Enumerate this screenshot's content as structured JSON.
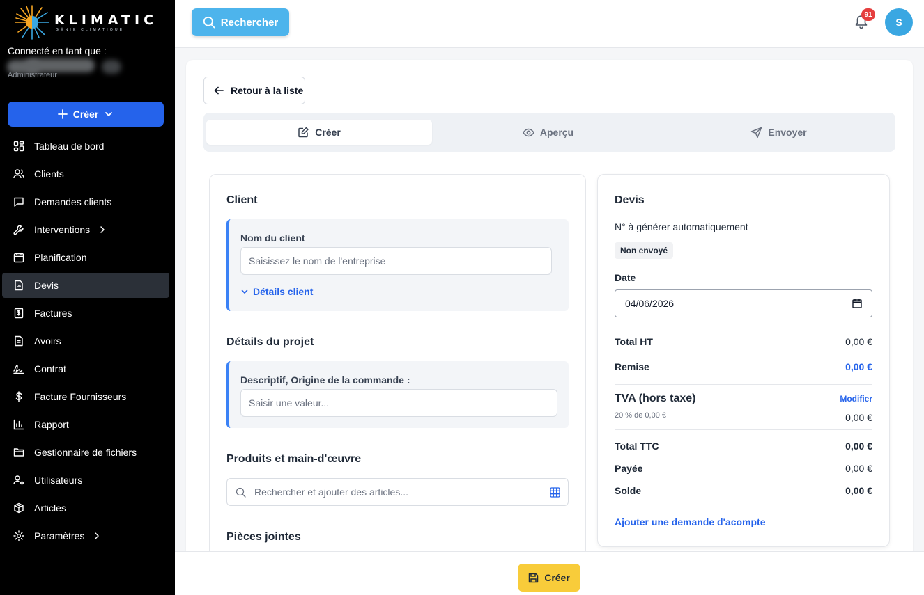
{
  "brand": {
    "name": "KLIMATIC",
    "tagline": "GÉNIE CLIMATIQUE"
  },
  "session": {
    "connected_label": "Connecté en tant que :",
    "role": "Administrateur"
  },
  "sidebar": {
    "create_label": "Créer",
    "items": [
      {
        "label": "Tableau de bord",
        "icon": "dashboard-icon"
      },
      {
        "label": "Clients",
        "icon": "users-icon"
      },
      {
        "label": "Demandes clients",
        "icon": "message-icon"
      },
      {
        "label": "Interventions",
        "icon": "wrench-icon"
      },
      {
        "label": "Planification",
        "icon": "calendar-icon"
      },
      {
        "label": "Devis",
        "icon": "quote-icon"
      },
      {
        "label": "Factures",
        "icon": "invoice-icon"
      },
      {
        "label": "Avoirs",
        "icon": "credit-note-icon"
      },
      {
        "label": "Contrat",
        "icon": "signature-icon"
      },
      {
        "label": "Facture Fournisseurs",
        "icon": "dollar-icon"
      },
      {
        "label": "Rapport",
        "icon": "chart-icon"
      },
      {
        "label": "Gestionnaire de fichiers",
        "icon": "folder-icon"
      },
      {
        "label": "Utilisateurs",
        "icon": "user-cog-icon"
      },
      {
        "label": "Articles",
        "icon": "package-icon"
      },
      {
        "label": "Paramètres",
        "icon": "settings-icon"
      }
    ],
    "active_item": "Devis"
  },
  "topbar": {
    "search_label": "Rechercher",
    "notification_count": "91",
    "avatar_initial": "S"
  },
  "main": {
    "back_label": "Retour à la liste",
    "tabs": [
      {
        "label": "Créer"
      },
      {
        "label": "Aperçu"
      },
      {
        "label": "Envoyer"
      }
    ]
  },
  "form": {
    "client_title": "Client",
    "client_name_label": "Nom du client",
    "client_name_placeholder": "Saisissez le nom de l'entreprise",
    "client_details_link": "Détails client",
    "project_title": "Détails du projet",
    "project_label": "Descriptif, Origine de la commande :",
    "project_placeholder": "Saisir une valeur...",
    "products_title": "Produits et main-d'œuvre",
    "products_placeholder": "Rechercher et ajouter des articles...",
    "attachments_title": "Pièces jointes"
  },
  "quote": {
    "title": "Devis",
    "number_text": "N° à générer automatiquement",
    "status": "Non envoyé",
    "date_label": "Date",
    "date_value": "04/06/2026",
    "total_ht_label": "Total HT",
    "total_ht_value": "0,00 €",
    "remise_label": "Remise",
    "remise_value": "0,00 €",
    "tva_label": "TVA (hors taxe)",
    "tva_modify": "Modifier",
    "tva_sub": "20 % de 0,00 €",
    "tva_value": "0,00 €",
    "total_ttc_label": "Total TTC",
    "total_ttc_value": "0,00 €",
    "payee_label": "Payée",
    "payee_value": "0,00 €",
    "solde_label": "Solde",
    "solde_value": "0,00 €",
    "acompte_link": "Ajouter une demande d'acompte"
  },
  "footer": {
    "create_label": "Créer"
  },
  "colors": {
    "sidebar_bg": "#000000",
    "primary": "#2563eb",
    "search_accent": "#4db4ec",
    "footer_button": "#f8cc3a",
    "badge": "#e53e3e"
  }
}
